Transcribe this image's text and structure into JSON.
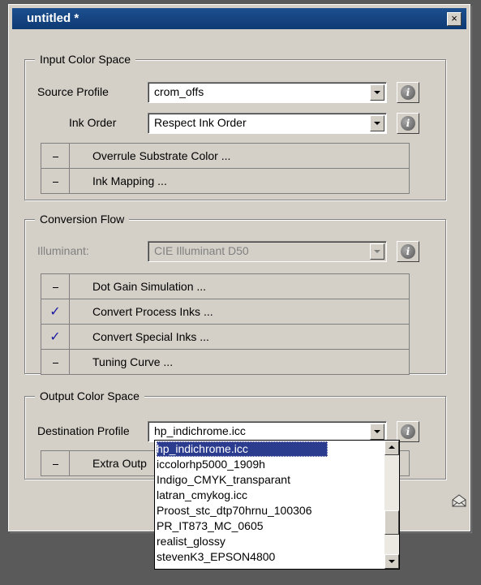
{
  "window": {
    "title": "untitled *",
    "close_label": "×"
  },
  "input_color_space": {
    "legend": "Input Color Space",
    "source_profile": {
      "label": "Source Profile",
      "value": "crom_offs"
    },
    "ink_order": {
      "label": "Ink Order",
      "value": "Respect Ink Order"
    },
    "options": [
      {
        "mark": "-",
        "label": "Overrule Substrate Color ..."
      },
      {
        "mark": "-",
        "label": "Ink Mapping ..."
      }
    ]
  },
  "conversion_flow": {
    "legend": "Conversion Flow",
    "illuminant": {
      "label": "Illuminant:",
      "value": "CIE Illuminant D50"
    },
    "options": [
      {
        "mark": "-",
        "label": "Dot Gain Simulation ..."
      },
      {
        "mark": "✓",
        "label": "Convert Process Inks ..."
      },
      {
        "mark": "✓",
        "label": "Convert Special Inks ..."
      },
      {
        "mark": "-",
        "label": "Tuning Curve ..."
      }
    ]
  },
  "output_color_space": {
    "legend": "Output Color Space",
    "destination_profile": {
      "label": "Destination Profile",
      "value": "hp_indichrome.icc"
    },
    "options": [
      {
        "mark": "-",
        "label": "Extra Outp"
      }
    ]
  },
  "dropdown": {
    "options": [
      "hp_indichrome.icc",
      "iccolorhp5000_1909h",
      "Indigo_CMYK_transparant",
      "latran_cmykog.icc",
      "Proost_stc_dtp70hrnu_100306",
      "PR_IT873_MC_0605",
      "realist_glossy",
      "stevenK3_EPSON4800"
    ],
    "selected_index": 0
  },
  "colors": {
    "titlebar": "#0e3a74",
    "selection": "#2b3c8f",
    "dialog": "#d4d0c8"
  }
}
